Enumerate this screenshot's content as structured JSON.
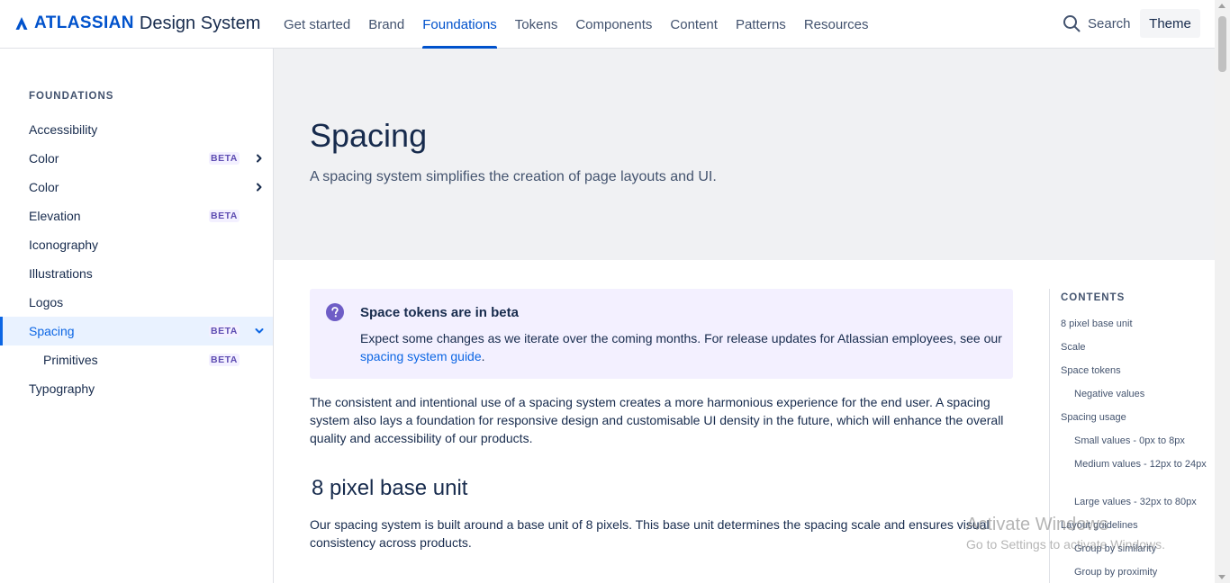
{
  "header": {
    "logo_word": "ATLASSIAN",
    "logo_product": "Design System",
    "nav": [
      "Get started",
      "Brand",
      "Foundations",
      "Tokens",
      "Components",
      "Content",
      "Patterns",
      "Resources"
    ],
    "active_nav": "Foundations",
    "search_label": "Search",
    "theme_label": "Theme"
  },
  "sidebar": {
    "heading": "FOUNDATIONS",
    "items": [
      {
        "label": "Accessibility",
        "badge": "",
        "chevron": "none"
      },
      {
        "label": "Color",
        "badge": "BETA",
        "chevron": "right"
      },
      {
        "label": "Color",
        "badge": "",
        "chevron": "right"
      },
      {
        "label": "Elevation",
        "badge": "BETA",
        "chevron": "none"
      },
      {
        "label": "Iconography",
        "badge": "",
        "chevron": "none"
      },
      {
        "label": "Illustrations",
        "badge": "",
        "chevron": "none"
      },
      {
        "label": "Logos",
        "badge": "",
        "chevron": "none"
      },
      {
        "label": "Spacing",
        "badge": "BETA",
        "chevron": "down",
        "selected": true
      },
      {
        "label": "Primitives",
        "badge": "BETA",
        "chevron": "none",
        "child": true
      },
      {
        "label": "Typography",
        "badge": "",
        "chevron": "none"
      }
    ]
  },
  "hero": {
    "title": "Spacing",
    "subtitle": "A spacing system simplifies the creation of page layouts and UI."
  },
  "notice": {
    "icon": "question-icon",
    "title": "Space tokens are in beta",
    "body": "Expect some changes as we iterate over the coming months. For release updates for Atlassian employees, see our",
    "link": "spacing system guide",
    "body_end": "."
  },
  "main": {
    "intro": "The consistent and intentional use of a spacing system creates a more harmonious experience for the end user. A spacing system also lays a foundation for responsive design and customisable UI density in the future, which will enhance the overall quality and accessibility of our products.",
    "section_title": "8 pixel base unit",
    "section_body": "Our spacing system is built around a base unit of 8 pixels. This base unit determines the spacing scale and ensures visual consistency across products."
  },
  "contents": {
    "heading": "CONTENTS",
    "items": [
      {
        "label": "8 pixel base unit",
        "level": 1
      },
      {
        "label": "Scale",
        "level": 1
      },
      {
        "label": "Space tokens",
        "level": 1
      },
      {
        "label": "Negative values",
        "level": 2
      },
      {
        "label": "Spacing usage",
        "level": 1
      },
      {
        "label": "Small values - 0px to 8px",
        "level": 2
      },
      {
        "label": "Medium values - 12px to 24px",
        "level": 2
      },
      {
        "label": "Large values - 32px to 80px",
        "level": 2
      },
      {
        "label": "Layout guidelines",
        "level": 1
      },
      {
        "label": "Group by similarity",
        "level": 2
      },
      {
        "label": "Group by proximity",
        "level": 2
      }
    ]
  },
  "watermark": {
    "line1": "Activate Windows",
    "line2": "Go to Settings to activate Windows."
  },
  "colors": {
    "brand": "#0052cc",
    "selected_bg": "#e9f2ff",
    "beta_badge": "#5e4db2",
    "notice_bg": "#f3f0ff",
    "hero_bg": "#f0f1f3"
  }
}
